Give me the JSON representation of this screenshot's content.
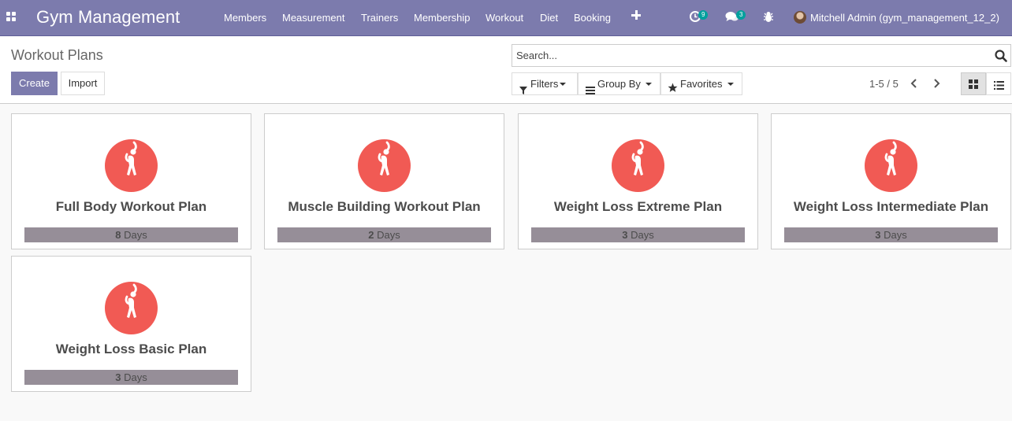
{
  "navbar": {
    "brand": "Gym Management",
    "menu": [
      {
        "label": "Members"
      },
      {
        "label": "Measurement"
      },
      {
        "label": "Trainers"
      },
      {
        "label": "Membership"
      },
      {
        "label": "Workout"
      },
      {
        "label": "Diet"
      },
      {
        "label": "Booking"
      }
    ],
    "activity_count": "9",
    "messages_count": "3",
    "user": "Mitchell Admin (gym_management_12_2)"
  },
  "control_panel": {
    "title": "Workout Plans",
    "create_label": "Create",
    "import_label": "Import",
    "search_placeholder": "Search...",
    "filters_label": "Filters",
    "group_by_label": "Group By",
    "favorites_label": "Favorites",
    "pager": "1-5 / 5"
  },
  "cards": [
    {
      "title": "Full Body Workout Plan",
      "days": "8",
      "days_unit": "Days"
    },
    {
      "title": "Muscle Building Workout Plan",
      "days": "2",
      "days_unit": "Days"
    },
    {
      "title": "Weight Loss Extreme Plan",
      "days": "3",
      "days_unit": "Days"
    },
    {
      "title": "Weight Loss Intermediate Plan",
      "days": "3",
      "days_unit": "Days"
    },
    {
      "title": "Weight Loss Basic Plan",
      "days": "3",
      "days_unit": "Days"
    }
  ],
  "colors": {
    "brand": "#7c7bad",
    "card_icon": "#f15a54",
    "days_bar": "#968e98",
    "badge": "#00a09d"
  },
  "icons": [
    "apps-grid-icon",
    "plus-icon",
    "activity-clock-icon",
    "chat-icon",
    "bug-icon",
    "search-icon",
    "filter-icon",
    "group-by-icon",
    "star-icon",
    "chevron-left-icon",
    "chevron-right-icon",
    "kanban-view-icon",
    "list-view-icon",
    "workout-person-icon"
  ]
}
